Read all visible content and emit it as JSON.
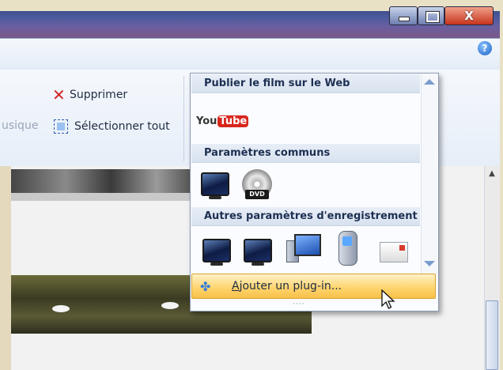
{
  "window": {
    "controls": {
      "minimize_icon": "minimize-icon",
      "maximize_icon": "maximize-icon",
      "close_glyph": "X"
    },
    "help_glyph": "?"
  },
  "ribbon": {
    "partial_label": "usique",
    "delete_label": "Supprimer",
    "select_all_label": "Sélectionner tout"
  },
  "save_menu": {
    "section_publish": "Publier le film sur le Web",
    "youtube": {
      "you": "You",
      "tube": "Tube"
    },
    "section_common": "Paramètres communs",
    "dvd_label": "DVD",
    "section_other": "Autres paramètres d'enregistrement",
    "add_plugin": {
      "accel": "A",
      "rest": "jouter un plug-in..."
    },
    "grip": "····"
  },
  "colors": {
    "accent": "#ffd36a",
    "delete_red": "#d32525",
    "youtube_red": "#d8261d"
  }
}
